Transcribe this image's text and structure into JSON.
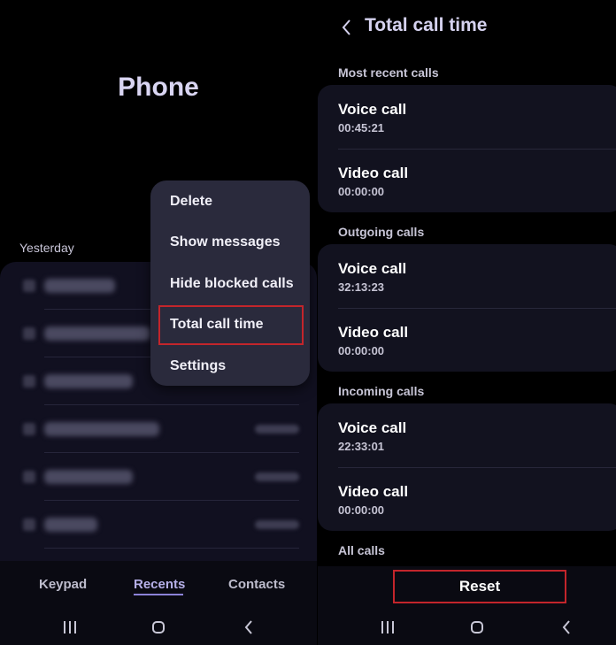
{
  "left_panel": {
    "app_title": "Phone",
    "section_label": "Yesterday",
    "recent_rows": [
      {
        "name_width": 80
      },
      {
        "name_width": 120
      },
      {
        "name_width": 100
      },
      {
        "name_width": 130
      },
      {
        "name_width": 100
      },
      {
        "name_width": 60
      }
    ],
    "menu": {
      "items": [
        "Delete",
        "Show messages",
        "Hide blocked calls",
        "Total call time",
        "Settings"
      ],
      "highlighted_item": "Total call time"
    },
    "tabs": [
      {
        "label": "Keypad",
        "active": false
      },
      {
        "label": "Recents",
        "active": true
      },
      {
        "label": "Contacts",
        "active": false
      }
    ]
  },
  "right_panel": {
    "title": "Total call time",
    "sections": [
      {
        "heading": "Most recent calls",
        "rows": [
          {
            "label": "Voice call",
            "value": "00:45:21"
          },
          {
            "label": "Video call",
            "value": "00:00:00"
          }
        ]
      },
      {
        "heading": "Outgoing calls",
        "rows": [
          {
            "label": "Voice call",
            "value": "32:13:23"
          },
          {
            "label": "Video call",
            "value": "00:00:00"
          }
        ]
      },
      {
        "heading": "Incoming calls",
        "rows": [
          {
            "label": "Voice call",
            "value": "22:33:01"
          },
          {
            "label": "Video call",
            "value": "00:00:00"
          }
        ]
      }
    ],
    "all_calls_heading": "All calls",
    "reset_label": "Reset"
  },
  "icons": {
    "nav_recent": "recent-apps-icon",
    "nav_home": "home-icon",
    "nav_back": "back-icon",
    "header_back": "chevron-left-icon"
  },
  "colors": {
    "accent": "#8c82d8",
    "highlight_box": "#c3252b",
    "card_bg": "#12121f",
    "menu_bg": "#2a2a3c"
  }
}
